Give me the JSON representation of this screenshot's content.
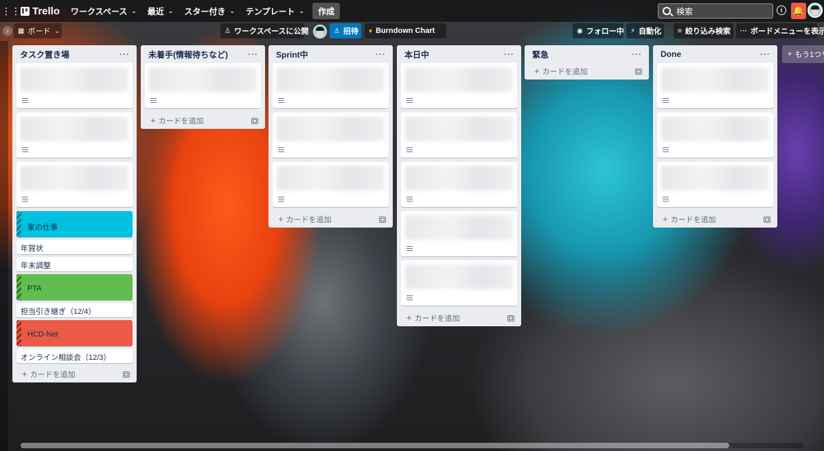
{
  "header": {
    "logo": "Trello",
    "menus": [
      "ワークスペース",
      "最近",
      "スター付き",
      "テンプレート"
    ],
    "create_label": "作成",
    "search_placeholder": "検索"
  },
  "board_bar": {
    "board_selector": "ボード",
    "visibility": "ワークスペースに公開",
    "invite": "招待",
    "powerup": "Burndown Chart",
    "follow": "フォロー中",
    "automation": "自動化",
    "filter": "絞り込み検索",
    "menu": "ボードメニューを表示"
  },
  "add_card_label": "カードを追加",
  "add_list_label": "もう1つリ",
  "lists": [
    {
      "title": "タスク置き場",
      "blurred_cards": 3,
      "cover_cards": [
        {
          "title": "家の仕事",
          "color": "#00c2e0",
          "stripe": "#1a7a8a",
          "after": [
            "年賀状",
            "年末調整"
          ]
        },
        {
          "title": "PTA",
          "color": "#61bd4f",
          "stripe": "#2f7a23",
          "after": [
            "担当引き継ぎ（12/4）"
          ]
        },
        {
          "title": "HCD-Net",
          "color": "#eb5a46",
          "stripe": "#9e2b1e",
          "after": [
            "オンライン相談会（12/3）"
          ]
        }
      ]
    },
    {
      "title": "未着手(情報待ちなど)",
      "blurred_cards": 1
    },
    {
      "title": "Sprint中",
      "blurred_cards": 3
    },
    {
      "title": "本日中",
      "blurred_cards": 5
    },
    {
      "title": "緊急",
      "blurred_cards": 0
    },
    {
      "title": "Done",
      "blurred_cards": 3
    }
  ]
}
